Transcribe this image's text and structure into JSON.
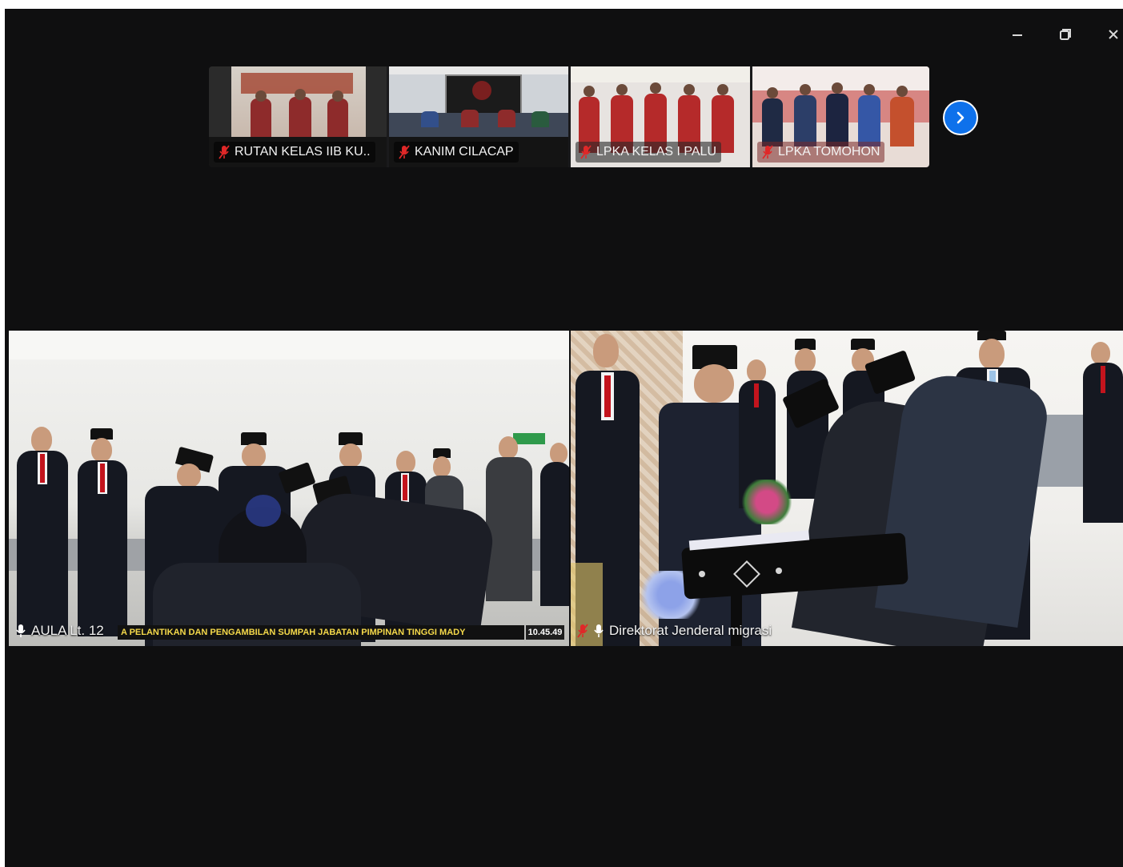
{
  "window": {
    "controls": [
      {
        "name": "minimize",
        "icon": "minimize-icon"
      },
      {
        "name": "restore",
        "icon": "restore-icon"
      },
      {
        "name": "close",
        "icon": "close-icon"
      }
    ]
  },
  "strip": {
    "participants": [
      {
        "name": "RUTAN KELAS IIB KU...",
        "muted": true
      },
      {
        "name": "KANIM CILACAP",
        "muted": true
      },
      {
        "name": "LPKA KELAS I PALU",
        "muted": true
      },
      {
        "name": "LPKA TOMOHON",
        "muted": true
      }
    ],
    "next_icon": "chevron-right-icon"
  },
  "main": {
    "videos": [
      {
        "name": "AULA Lt. 12",
        "active_speaker": true,
        "ticker": "A PELANTIKAN DAN PENGAMBILAN SUMPAH JABATAN PIMPINAN TINGGI MADY",
        "clock": "10.45.49"
      },
      {
        "name": "Direktorat Jenderal  migrasi",
        "active_speaker": false
      }
    ]
  },
  "colors": {
    "background": "#0f0f10",
    "active_speaker_border": "#2bd46b",
    "accent_blue": "#0e71eb",
    "mute_red": "#e02828",
    "uniform_red": "#b52a2a"
  }
}
